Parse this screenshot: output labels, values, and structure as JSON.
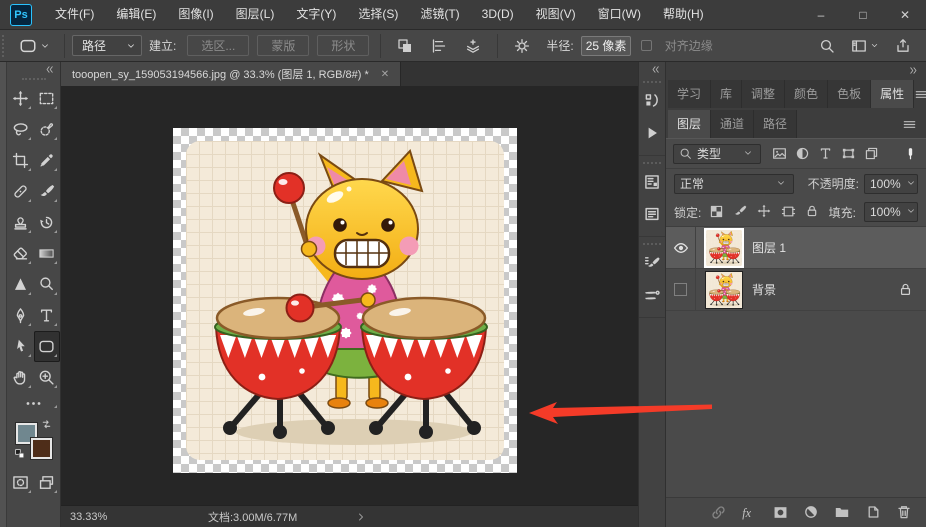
{
  "window": {
    "logo_text": "Ps",
    "controls": {
      "minimize": "–",
      "maximize": "□",
      "close": "✕"
    }
  },
  "menu_bar": {
    "items": [
      "文件(F)",
      "编辑(E)",
      "图像(I)",
      "图层(L)",
      "文字(Y)",
      "选择(S)",
      "滤镜(T)",
      "3D(D)",
      "视图(V)",
      "窗口(W)",
      "帮助(H)"
    ]
  },
  "options_bar": {
    "tool_mode": "路径",
    "make_label": "建立:",
    "make_buttons": [
      "选区...",
      "蒙版",
      "形状"
    ],
    "radius_label": "半径:",
    "radius_value": "25 像素",
    "align_edges": "对齐边缘"
  },
  "toolbar": {
    "foreground_color": "#70878f",
    "background_color": "#4e2d19",
    "tools": [
      {
        "name": "move-tool",
        "icon": "move"
      },
      {
        "name": "marquee-tool",
        "icon": "marquee"
      },
      {
        "name": "lasso-tool",
        "icon": "lasso"
      },
      {
        "name": "quick-selection-tool",
        "icon": "quick-select"
      },
      {
        "name": "crop-tool",
        "icon": "crop"
      },
      {
        "name": "eyedropper-tool",
        "icon": "eyedropper"
      },
      {
        "name": "spot-healing-tool",
        "icon": "healing"
      },
      {
        "name": "brush-tool",
        "icon": "brush"
      },
      {
        "name": "clone-stamp-tool",
        "icon": "stamp"
      },
      {
        "name": "history-brush-tool",
        "icon": "history-brush"
      },
      {
        "name": "eraser-tool",
        "icon": "eraser"
      },
      {
        "name": "gradient-tool",
        "icon": "gradient"
      },
      {
        "name": "sharpen-tool",
        "icon": "sharpen"
      },
      {
        "name": "dodge-tool",
        "icon": "dodge"
      },
      {
        "name": "pen-tool",
        "icon": "pen"
      },
      {
        "name": "type-tool",
        "icon": "type"
      },
      {
        "name": "path-select-tool",
        "icon": "path-select"
      },
      {
        "name": "rounded-rectangle-tool",
        "icon": "rounded-rect",
        "active": true
      },
      {
        "name": "hand-tool",
        "icon": "hand"
      },
      {
        "name": "zoom-tool",
        "icon": "zoom"
      }
    ]
  },
  "document": {
    "tab_title": "tooopen_sy_159053194566.jpg @ 33.3% (图层 1, RGB/8#) *",
    "close_glyph": "✕"
  },
  "dock_strip": {
    "panels": [
      {
        "name": "history-panel",
        "icon": "history-panel"
      },
      {
        "name": "actions-panel",
        "icon": "play"
      },
      {
        "name": "info-panel",
        "icon": "panel-a"
      },
      {
        "name": "notes-panel",
        "icon": "panel-b"
      },
      {
        "name": "brush-settings-panel",
        "icon": "brush-settings"
      },
      {
        "name": "brushes-panel",
        "icon": "brushes"
      }
    ]
  },
  "right_panel": {
    "top_tabs": [
      {
        "label": "学习",
        "active": false,
        "gap_after": false
      },
      {
        "label": "库",
        "active": false,
        "gap_after": true
      },
      {
        "label": "调整",
        "active": false,
        "gap_after": false
      },
      {
        "label": "颜色",
        "active": false,
        "gap_after": false
      },
      {
        "label": "色板",
        "active": false,
        "gap_after": false
      },
      {
        "label": "属性",
        "active": true,
        "gap_after": false
      }
    ],
    "layer_tabs": [
      {
        "label": "图层",
        "active": true
      },
      {
        "label": "通道",
        "active": false
      },
      {
        "label": "路径",
        "active": false
      }
    ],
    "layers_panel": {
      "filter_label": "类型",
      "blend_mode": "正常",
      "opacity_label": "不透明度:",
      "opacity_value": "100%",
      "lock_label": "锁定:",
      "fill_label": "填充:",
      "fill_value": "100%",
      "layers": [
        {
          "name": "图层 1",
          "visible": true,
          "selected": true,
          "locked": false,
          "transparent_thumb": true
        },
        {
          "name": "背景",
          "visible": false,
          "selected": false,
          "locked": true,
          "transparent_thumb": false
        }
      ]
    }
  },
  "status_bar": {
    "zoom_level": "33.33%",
    "doc_size": "文档:3.00M/6.77M"
  },
  "annotation": {
    "color": "#f43b28"
  }
}
